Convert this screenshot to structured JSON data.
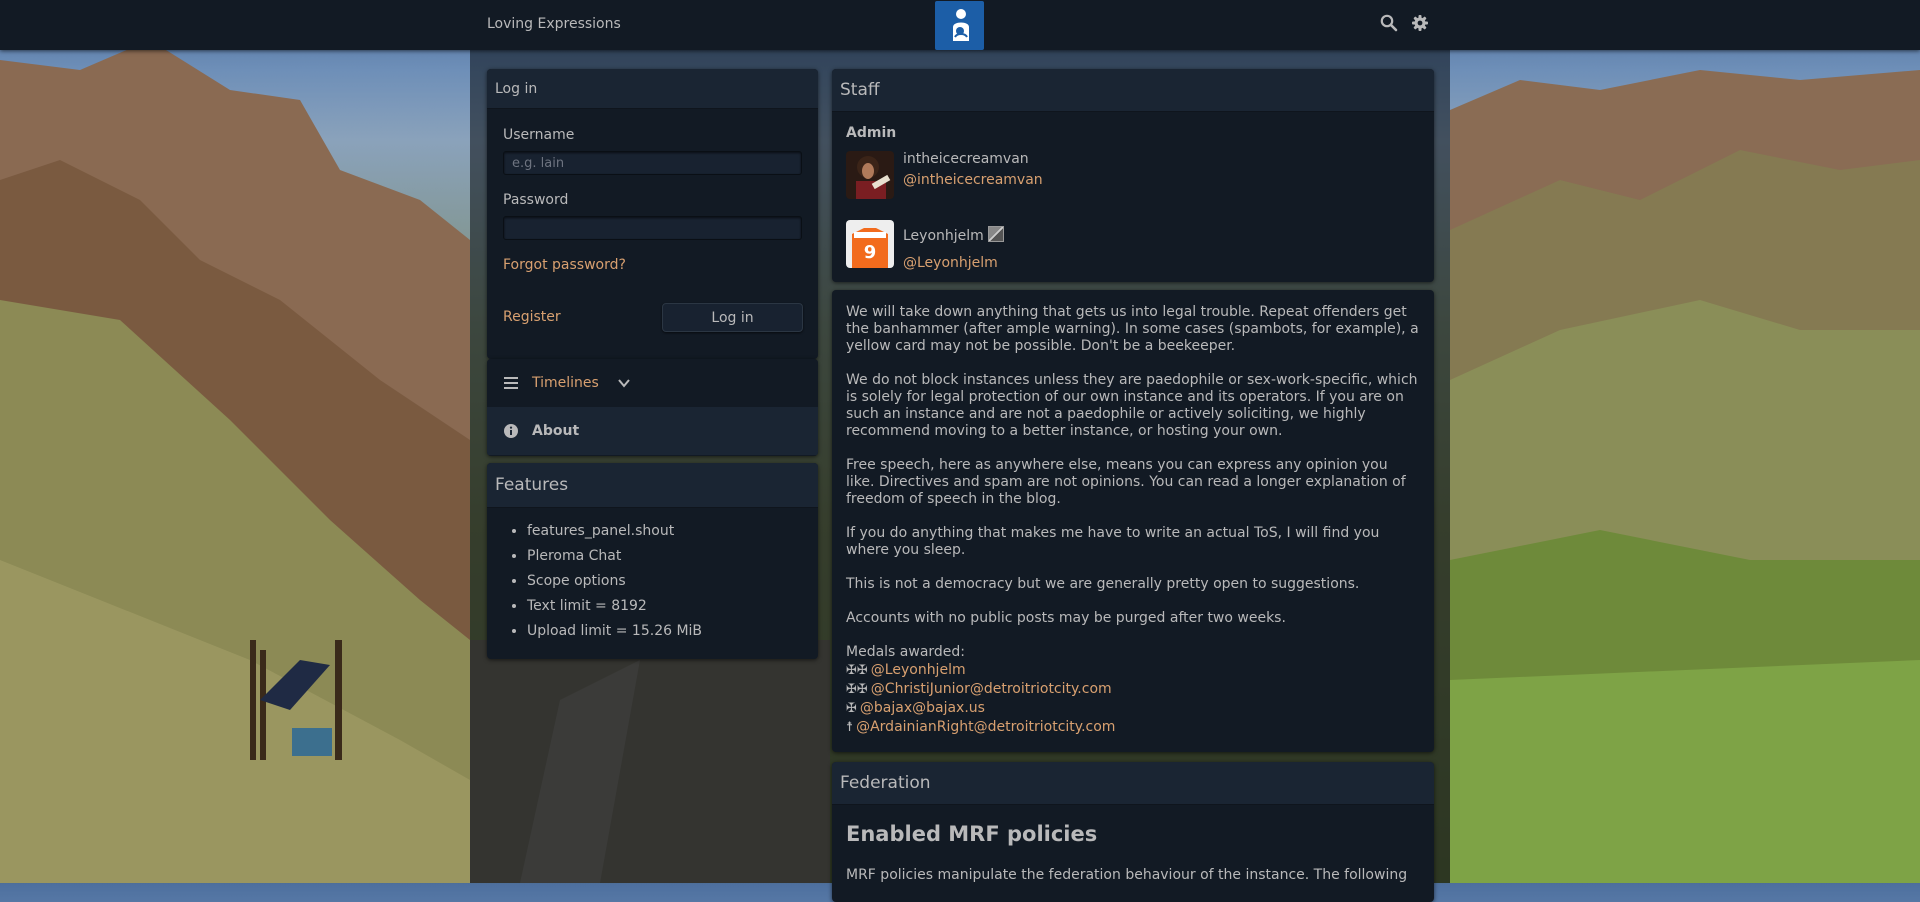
{
  "header": {
    "site_title": "Loving Expressions",
    "logo_icon": "parent-child-logo-icon",
    "search_icon": "search-icon",
    "settings_icon": "gear-icon"
  },
  "login": {
    "title": "Log in",
    "username_label": "Username",
    "username_placeholder": "e.g. lain",
    "username_value": "",
    "password_label": "Password",
    "password_value": "",
    "forgot_label": "Forgot password?",
    "register_label": "Register",
    "login_button": "Log in"
  },
  "nav": {
    "timelines_label": "Timelines",
    "about_label": "About"
  },
  "features": {
    "title": "Features",
    "items": [
      "features_panel.shout",
      "Pleroma Chat",
      "Scope options",
      "Text limit = 8192",
      "Upload limit = 15.26 MiB"
    ]
  },
  "staff": {
    "title": "Staff",
    "role": "Admin",
    "members": [
      {
        "name": "intheicecreamvan",
        "handle": "@intheicecreamvan"
      },
      {
        "name": "Leyonhjelm",
        "handle": "@Leyonhjelm"
      }
    ]
  },
  "description": {
    "paragraphs": [
      "We will take down anything that gets us into legal trouble. Repeat offenders get the banhammer (after ample warning). In some cases (spambots, for example), a yellow card may not be possible. Don't be a beekeeper.",
      "We do not block instances unless they are paedophile or sex-work-specific, which is solely for legal protection of our own instance and its operators. If you are on such an instance and are not a paedophile or actively soliciting, we highly recommend moving to a better instance, or hosting your own.",
      "Free speech, here as anywhere else, means you can express any opinion you like. Directives and spam are not opinions. You can read a longer explanation of freedom of speech in the blog.",
      "If you do anything that makes me have to write an actual ToS, I will find you where you sleep.",
      "This is not a democracy but we are generally pretty open to suggestions.",
      "Accounts with no public posts may be purged after two weeks."
    ],
    "medals_heading": "Medals awarded:",
    "medals": [
      {
        "icons": "✠✠",
        "handle": "@Leyonhjelm"
      },
      {
        "icons": "✠✠",
        "handle": "@ChristiJunior@detroitriotcity.com"
      },
      {
        "icons": "✠",
        "handle": "@bajax@bajax.us"
      },
      {
        "icons": "☨",
        "handle": "@ArdainianRight@detroitriotcity.com"
      }
    ]
  },
  "federation": {
    "title": "Federation",
    "subtitle": "Enabled MRF policies",
    "text": "MRF policies manipulate the federation behaviour of the instance. The following"
  },
  "colors": {
    "link": "#d8a070",
    "panel": "#121a24",
    "panel_heading": "#1a2533",
    "topbar": "#121a24",
    "logo_bg": "#1c5ea7"
  }
}
